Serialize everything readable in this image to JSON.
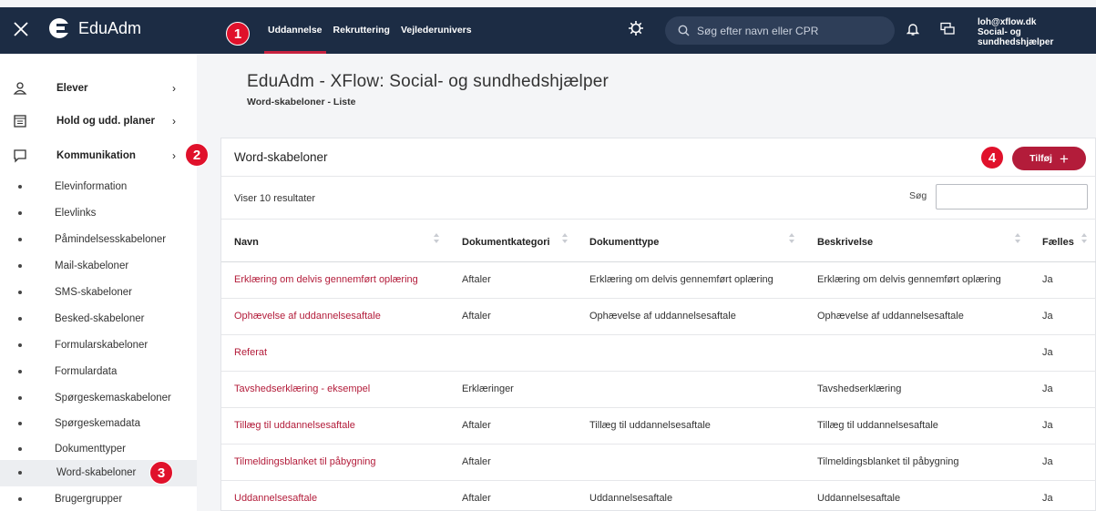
{
  "app": {
    "name": "EduAdm",
    "colors": {
      "topbar": "#1c2c44",
      "accent": "#b31c3a",
      "badge": "#e0112b"
    }
  },
  "topbar": {
    "nav": [
      "Uddannelse",
      "Rekruttering",
      "Vejlederunivers"
    ],
    "active_nav": "Uddannelse",
    "search_placeholder": "Søg efter navn eller CPR",
    "user_email": "loh@xflow.dk",
    "user_org": "Social- og sundhedshjælper"
  },
  "sidebar": {
    "main": [
      {
        "label": "Elever",
        "icon": "person-icon"
      },
      {
        "label": "Hold og udd. planer",
        "icon": "calendar-icon"
      },
      {
        "label": "Kommunikation",
        "icon": "chat-icon"
      }
    ],
    "sub": [
      "Elevinformation",
      "Elevlinks",
      "Påmindelsesskabeloner",
      "Mail-skabeloner",
      "SMS-skabeloner",
      "Besked-skabeloner",
      "Formularskabeloner",
      "Formulardata",
      "Spørgeskemaskabeloner",
      "Spørgeskemadata",
      "Dokumenttyper",
      "Word-skabeloner",
      "Brugergrupper"
    ],
    "active_sub": "Word-skabeloner"
  },
  "badges": [
    "1",
    "2",
    "3",
    "4"
  ],
  "page": {
    "title": "EduAdm - XFlow: Social- og sundhedshjælper",
    "breadcrumb": "Word-skabeloner - Liste"
  },
  "card": {
    "title": "Word-skabeloner",
    "add_label": "Tilføj",
    "results_text": "Viser 10 resultater",
    "search_label": "Søg",
    "search_value": "",
    "columns": [
      "Navn",
      "Dokumentkategori",
      "Dokumenttype",
      "Beskrivelse",
      "Fælles"
    ],
    "rows": [
      [
        "Erklæring om delvis gennemført oplæring",
        "Aftaler",
        "Erklæring om delvis gennemført oplæring",
        "Erklæring om delvis gennemført oplæring",
        "Ja"
      ],
      [
        "Ophævelse af uddannelsesaftale",
        "Aftaler",
        "Ophævelse af uddannelsesaftale",
        "Ophævelse af uddannelsesaftale",
        "Ja"
      ],
      [
        "Referat",
        "",
        "",
        "",
        "Ja"
      ],
      [
        "Tavshedserklæring - eksempel",
        "Erklæringer",
        "",
        "Tavshedserklæring",
        "Ja"
      ],
      [
        "Tillæg til uddannelsesaftale",
        "Aftaler",
        "Tillæg til uddannelsesaftale",
        "Tillæg til uddannelsesaftale",
        "Ja"
      ],
      [
        "Tilmeldingsblanket til påbygning",
        "Aftaler",
        "",
        "Tilmeldingsblanket til påbygning",
        "Ja"
      ],
      [
        "Uddannelsesaftale",
        "Aftaler",
        "Uddannelsesaftale",
        "Uddannelsesaftale",
        "Ja"
      ]
    ]
  }
}
